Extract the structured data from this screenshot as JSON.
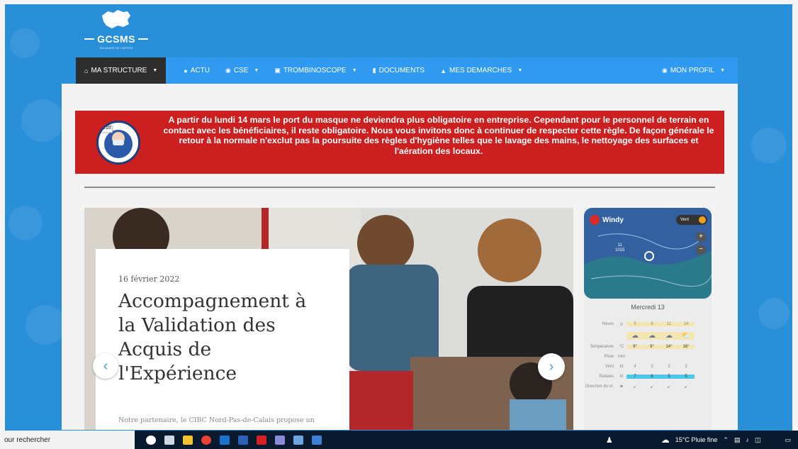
{
  "logo": {
    "text": "GCSMS",
    "subtitle": "SOLIDAIRE DE L'ARTOIS"
  },
  "nav": {
    "items": [
      {
        "label": "MA STRUCTURE",
        "icon": "home-icon",
        "glyph": "⌂",
        "dropdown": true,
        "active": true
      },
      {
        "label": "ACTU",
        "icon": "pin-icon",
        "glyph": "●",
        "dropdown": false
      },
      {
        "label": "CSE",
        "icon": "cse-icon",
        "glyph": "◉",
        "dropdown": true
      },
      {
        "label": "TROMBINOSCOPE",
        "icon": "camera-icon",
        "glyph": "▣",
        "dropdown": true
      },
      {
        "label": "DOCUMENTS",
        "icon": "document-icon",
        "glyph": "▮",
        "dropdown": false
      },
      {
        "label": "MES DEMARCHES",
        "icon": "user-icon",
        "glyph": "▲",
        "dropdown": true
      }
    ],
    "profile": {
      "label": "MON PROFIL",
      "icon": "user-circle-icon",
      "glyph": "◉"
    }
  },
  "alert": {
    "text": "A partir du lundi 14 mars le port du masque ne deviendra plus obligatoire en entreprise. Cependant pour le personnel de terrain en contact avec les bénéficiaires, il reste obligatoire. Nous vous invitons donc à continuer de respecter cette règle. De façon générale le retour à la normale n'exclut pas la poursuite des règles d'hygiène telles que le lavage des mains, le nettoyage des surfaces et l'aération des locaux.",
    "icon_badge": "Edit",
    "icon": "mask-icon"
  },
  "article": {
    "date": "16 février 2022",
    "title": "Accompagnement à la Validation des Acquis de l'Expérience",
    "excerpt": "Notre partenaire, le CIBC Nord-Pas-de-Calais propose un accompagnement à la VAE."
  },
  "carousel": {
    "prev": "‹",
    "next": "›"
  },
  "weather": {
    "brand": "Windy",
    "toggle": "Vent",
    "zoom_in": "+",
    "zoom_out": "−",
    "map_label": "11",
    "map_sublabel": "1015",
    "day": "Mercredi 13",
    "rows": [
      {
        "label": "Heure",
        "unit": "⊙",
        "values": [
          "5",
          "8",
          "11",
          "14"
        ]
      },
      {
        "label": "",
        "unit": "",
        "values": [
          "☁",
          "☁",
          "☁",
          "⛅"
        ]
      },
      {
        "label": "Température",
        "unit": "°C",
        "values": [
          "9°",
          "9°",
          "14°",
          "16°"
        ]
      },
      {
        "label": "Pluie",
        "unit": "mm",
        "values": [
          "",
          "",
          "",
          ""
        ]
      },
      {
        "label": "Vent",
        "unit": "kt",
        "values": [
          "4",
          "3",
          "2",
          "3"
        ]
      },
      {
        "label": "Rafales",
        "unit": "kt",
        "values": [
          "7",
          "6",
          "5",
          "5"
        ]
      },
      {
        "label": "Direction du vt.",
        "unit": "⚑",
        "values": [
          "➹",
          "➹",
          "➹",
          "➹"
        ]
      }
    ]
  },
  "taskbar": {
    "search_text": "our rechercher",
    "weather": "15°C Pluie fine",
    "apps": [
      {
        "name": "cortana-icon",
        "color": "#ffffff",
        "round": true
      },
      {
        "name": "task-view-icon",
        "color": "#cfd8e3"
      },
      {
        "name": "file-explorer-icon",
        "color": "#f2c230"
      },
      {
        "name": "chrome-icon",
        "color": "#e94235",
        "round": true
      },
      {
        "name": "outlook-icon",
        "color": "#1b72c8"
      },
      {
        "name": "word-icon",
        "color": "#2b5fb8"
      },
      {
        "name": "acrobat-icon",
        "color": "#d42020"
      },
      {
        "name": "teams-icon",
        "color": "#8a8ad8"
      },
      {
        "name": "app-icon",
        "color": "#6aa7e0"
      },
      {
        "name": "settings-app-icon",
        "color": "#3d7fd6"
      }
    ],
    "tray": [
      "⌃",
      "▤",
      "♪",
      "◫",
      "▭"
    ]
  }
}
